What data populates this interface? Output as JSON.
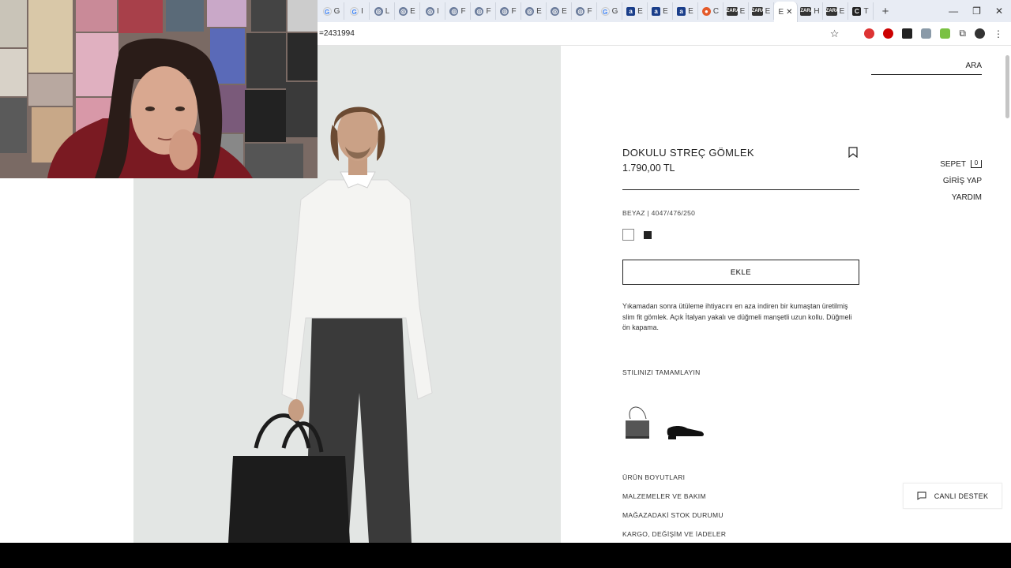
{
  "browser": {
    "tabs": [
      {
        "favicon": "G",
        "label": "G",
        "style": "g"
      },
      {
        "favicon": "G",
        "label": "I",
        "style": "g"
      },
      {
        "favicon": "◎",
        "label": "L",
        "style": "o"
      },
      {
        "favicon": "◎",
        "label": "E",
        "style": "o"
      },
      {
        "favicon": "◎",
        "label": "I",
        "style": "o"
      },
      {
        "favicon": "◎",
        "label": "F",
        "style": "o"
      },
      {
        "favicon": "◎",
        "label": "F",
        "style": "o"
      },
      {
        "favicon": "◎",
        "label": "F",
        "style": "o"
      },
      {
        "favicon": "◎",
        "label": "E",
        "style": "o"
      },
      {
        "favicon": "◎",
        "label": "E",
        "style": "o"
      },
      {
        "favicon": "◎",
        "label": "F",
        "style": "o"
      },
      {
        "favicon": "G",
        "label": "G",
        "style": "g"
      },
      {
        "favicon": "a",
        "label": "E",
        "style": "a"
      },
      {
        "favicon": "a",
        "label": "E",
        "style": "a"
      },
      {
        "favicon": "a",
        "label": "E",
        "style": "a"
      },
      {
        "favicon": "●",
        "label": "C",
        "style": "r"
      },
      {
        "favicon": "ZARA",
        "label": "E",
        "style": "z"
      },
      {
        "favicon": "ZARA",
        "label": "E",
        "style": "z"
      },
      {
        "favicon": "",
        "label": "E",
        "style": "active"
      },
      {
        "favicon": "ZARA",
        "label": "H",
        "style": "z"
      },
      {
        "favicon": "ZARA",
        "label": "E",
        "style": "z"
      },
      {
        "favicon": "C",
        "label": "T",
        "style": "c"
      }
    ],
    "new_tab": "+",
    "url": "=2431994",
    "window_controls": {
      "minimize": "—",
      "restore": "❐",
      "close": "✕"
    },
    "tab_close": "✕"
  },
  "header": {
    "search": "ARA",
    "cart_label": "SEPET",
    "cart_count": "0",
    "login": "GİRİŞ YAP",
    "help": "YARDIM"
  },
  "product": {
    "title": "DOKULU STREÇ GÖMLEK",
    "price": "1.790,00 TL",
    "color_info": "BEYAZ | 4047/476/250",
    "add_button": "EKLE",
    "description": "Yıkamadan sonra ütüleme ihtiyacını en aza indiren bir kumaştan üretilmiş slim fit gömlek. Açık İtalyan yakalı ve düğmeli manşetli uzun kollu. Düğmeli ön kapama.",
    "complete_look": "STILINIZI TAMAMLAYIN",
    "accordion": [
      "ÜRÜN BOYUTLARI",
      "MALZEMELER VE BAKIM",
      "MAĞAZADAKİ STOK DURUMU",
      "KARGO, DEĞİŞİM VE İADELER"
    ]
  },
  "live_chat": "CANLI DESTEK",
  "colors": {
    "photo_bg": "#e3e6e4",
    "shirt": "#f4f4f2",
    "trousers": "#3a3a3a",
    "bag": "#1c1c1c",
    "tabstrip": "#e8ecf4"
  }
}
